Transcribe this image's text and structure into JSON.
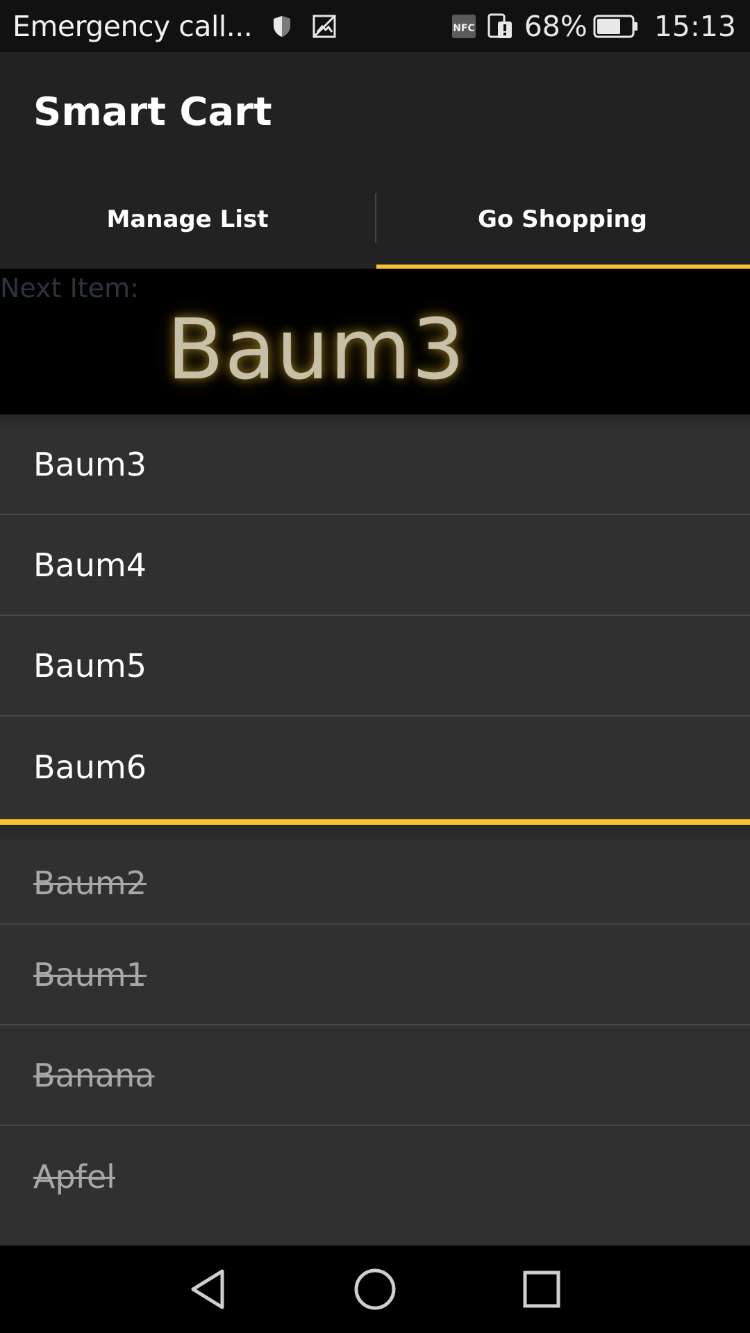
{
  "status_bar": {
    "carrier": "Emergency call...",
    "battery_percent": "68%",
    "time": "15:13",
    "icons": [
      "shield-icon",
      "image-icon",
      "nfc-icon",
      "sim-alert-icon",
      "battery-icon"
    ],
    "battery_level": 0.68
  },
  "app": {
    "title": "Smart Cart"
  },
  "tabs": [
    {
      "label": "Manage List",
      "selected": false
    },
    {
      "label": "Go Shopping",
      "selected": true
    }
  ],
  "next_item": {
    "label": "Next Item:",
    "value": "Baum3"
  },
  "open_items": [
    {
      "label": "Baum3"
    },
    {
      "label": "Baum4"
    },
    {
      "label": "Baum5"
    },
    {
      "label": "Baum6"
    }
  ],
  "done_items": [
    {
      "label": "Baum2"
    },
    {
      "label": "Baum1"
    },
    {
      "label": "Banana"
    },
    {
      "label": "Apfel"
    }
  ],
  "nav": {
    "icons": [
      "back-icon",
      "home-icon",
      "recents-icon"
    ]
  },
  "colors": {
    "accent": "#f7c232",
    "app_bar": "#222222",
    "list_bg": "#303030"
  }
}
